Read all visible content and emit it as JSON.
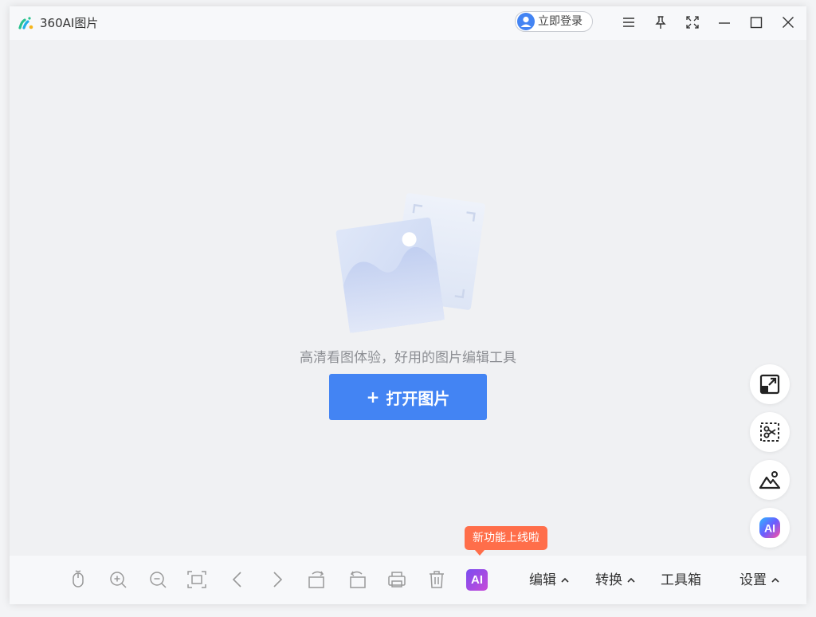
{
  "titlebar": {
    "app_title": "360AI图片",
    "login_label": "立即登录",
    "icons": [
      "menu-icon",
      "pin-icon",
      "fullscreen-icon",
      "minimize-icon",
      "maximize-icon",
      "close-icon"
    ]
  },
  "main": {
    "tagline": "高清看图体验，好用的图片编辑工具",
    "open_button_plus": "+",
    "open_button_label": "打开图片"
  },
  "side_buttons": [
    "resize-icon",
    "smart-cutout-icon",
    "image-enhance-icon",
    "ai-icon"
  ],
  "side_ai_label": "AI",
  "tooltip": {
    "text": "新功能上线啦"
  },
  "bottombar": {
    "icons": [
      "mouse-icon",
      "zoom-in-icon",
      "zoom-out-icon",
      "fit-screen-icon",
      "prev-icon",
      "next-icon",
      "rotate-left-icon",
      "rotate-right-icon",
      "print-icon",
      "delete-icon"
    ],
    "ai_label": "AI",
    "edit_label": "编辑",
    "convert_label": "转换",
    "toolbox_label": "工具箱",
    "settings_label": "设置"
  },
  "colors": {
    "accent": "#4384f3",
    "tooltip": "#ff6e4a",
    "background": "#f0f1f3"
  }
}
